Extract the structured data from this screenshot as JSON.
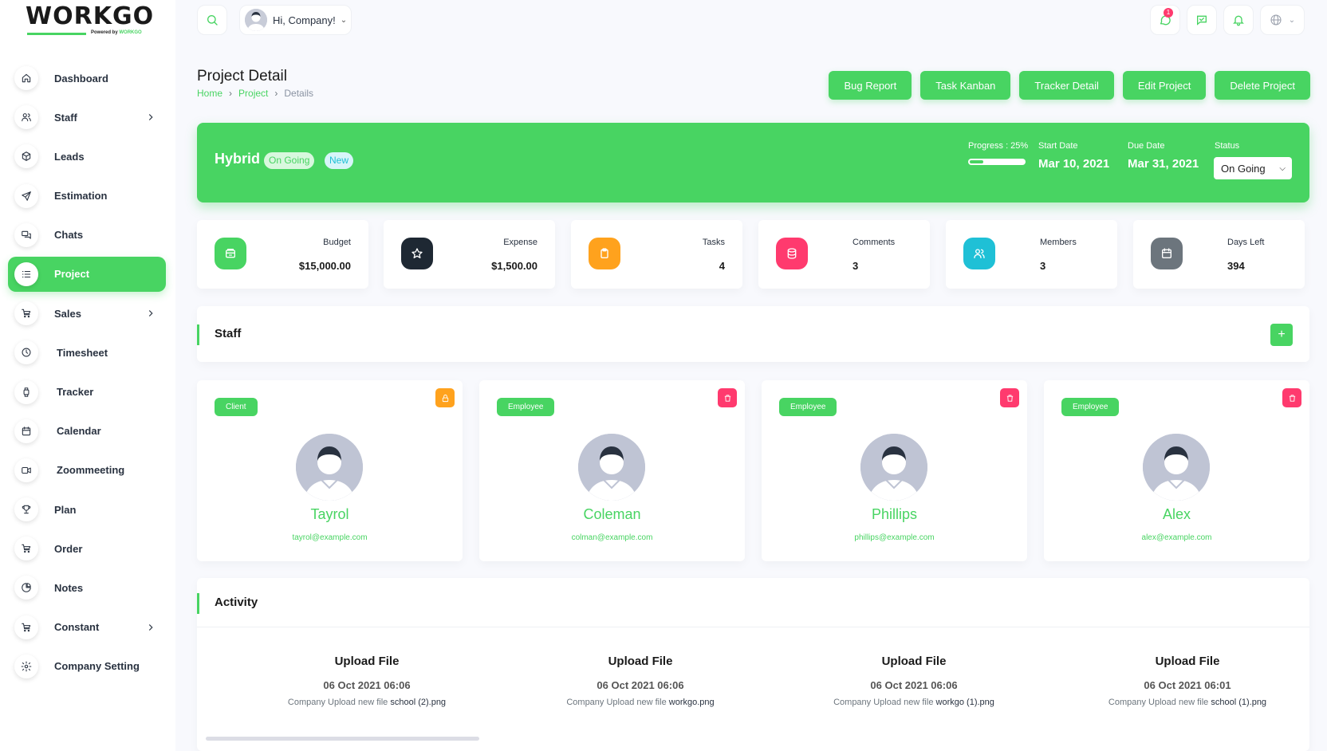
{
  "brand": {
    "logo_text": "WORKGO",
    "powered_by": "Powered by",
    "powered_brand": "WORKGO"
  },
  "sidebar": {
    "items": [
      {
        "label": "Dashboard",
        "icon": "home-icon",
        "chevron": false
      },
      {
        "label": "Staff",
        "icon": "users-icon",
        "chevron": true
      },
      {
        "label": "Leads",
        "icon": "box-icon",
        "chevron": false
      },
      {
        "label": "Estimation",
        "icon": "send-icon",
        "chevron": false
      },
      {
        "label": "Chats",
        "icon": "chat-icon",
        "chevron": false
      },
      {
        "label": "Project",
        "icon": "list-icon",
        "chevron": false,
        "active": true
      },
      {
        "label": "Sales",
        "icon": "cart-icon",
        "chevron": true
      },
      {
        "label": "Timesheet",
        "icon": "clock-icon",
        "chevron": false
      },
      {
        "label": "Tracker",
        "icon": "watch-icon",
        "chevron": false
      },
      {
        "label": "Calendar",
        "icon": "calendar-icon",
        "chevron": false
      },
      {
        "label": "Zoommeeting",
        "icon": "video-icon",
        "chevron": false
      },
      {
        "label": "Plan",
        "icon": "trophy-icon",
        "chevron": false
      },
      {
        "label": "Order",
        "icon": "cart-dollar-icon",
        "chevron": false
      },
      {
        "label": "Notes",
        "icon": "pie-icon",
        "chevron": false
      },
      {
        "label": "Constant",
        "icon": "cart-icon",
        "chevron": true
      },
      {
        "label": "Company Setting",
        "icon": "gear-icon",
        "chevron": false
      }
    ]
  },
  "topbar": {
    "greeting": "Hi, Company!",
    "messages_badge": "1"
  },
  "header": {
    "title": "Project Detail",
    "breadcrumb": [
      "Home",
      "Project",
      "Details"
    ],
    "actions": [
      "Bug Report",
      "Task Kanban",
      "Tracker Detail",
      "Edit Project",
      "Delete Project"
    ]
  },
  "project": {
    "name": "Hybrid",
    "status_pill": "On Going",
    "tag_pill": "New",
    "progress_label": "Progress : 25%",
    "progress_fraction": 0.25,
    "start_label": "Start Date",
    "start_date": "Mar 10, 2021",
    "due_label": "Due Date",
    "due_date": "Mar 31, 2021",
    "status_label": "Status",
    "status_value": "On Going"
  },
  "stats": [
    {
      "label": "Budget",
      "value": "$15,000.00",
      "color": "#48d462",
      "icon": "wallet-icon"
    },
    {
      "label": "Expense",
      "value": "$1,500.00",
      "color": "#1e2833",
      "icon": "star-icon"
    },
    {
      "label": "Tasks",
      "value": "4",
      "color": "#ffa21d",
      "icon": "clipboard-icon"
    },
    {
      "label": "Comments",
      "value": "3",
      "color": "#ff3a6e",
      "icon": "database-icon"
    },
    {
      "label": "Members",
      "value": "3",
      "color": "#1fc0d6",
      "icon": "users-icon"
    },
    {
      "label": "Days Left",
      "value": "394",
      "color": "#6c757d",
      "icon": "calendar-icon"
    }
  ],
  "staff": {
    "title": "Staff",
    "members": [
      {
        "role": "Client",
        "name": "Tayrol",
        "email": "tayrol@example.com",
        "action": "lock",
        "action_color": "#ffa21d"
      },
      {
        "role": "Employee",
        "name": "Coleman",
        "email": "colman@example.com",
        "action": "delete",
        "action_color": "#ff3a6e"
      },
      {
        "role": "Employee",
        "name": "Phillips",
        "email": "phillips@example.com",
        "action": "delete",
        "action_color": "#ff3a6e"
      },
      {
        "role": "Employee",
        "name": "Alex",
        "email": "alex@example.com",
        "action": "delete",
        "action_color": "#ff3a6e"
      }
    ]
  },
  "activity": {
    "title": "Activity",
    "items": [
      {
        "title": "Upload File",
        "date": "06 Oct 2021 06:06",
        "desc": "Company Upload new file",
        "file": "school (2).png"
      },
      {
        "title": "Upload File",
        "date": "06 Oct 2021 06:06",
        "desc": "Company Upload new file",
        "file": "workgo.png"
      },
      {
        "title": "Upload File",
        "date": "06 Oct 2021 06:06",
        "desc": "Company Upload new file",
        "file": "workgo (1).png"
      },
      {
        "title": "Upload File",
        "date": "06 Oct 2021 06:01",
        "desc": "Company Upload new file",
        "file": "school (1).png"
      }
    ]
  },
  "colors": {
    "accent": "#48d462"
  }
}
